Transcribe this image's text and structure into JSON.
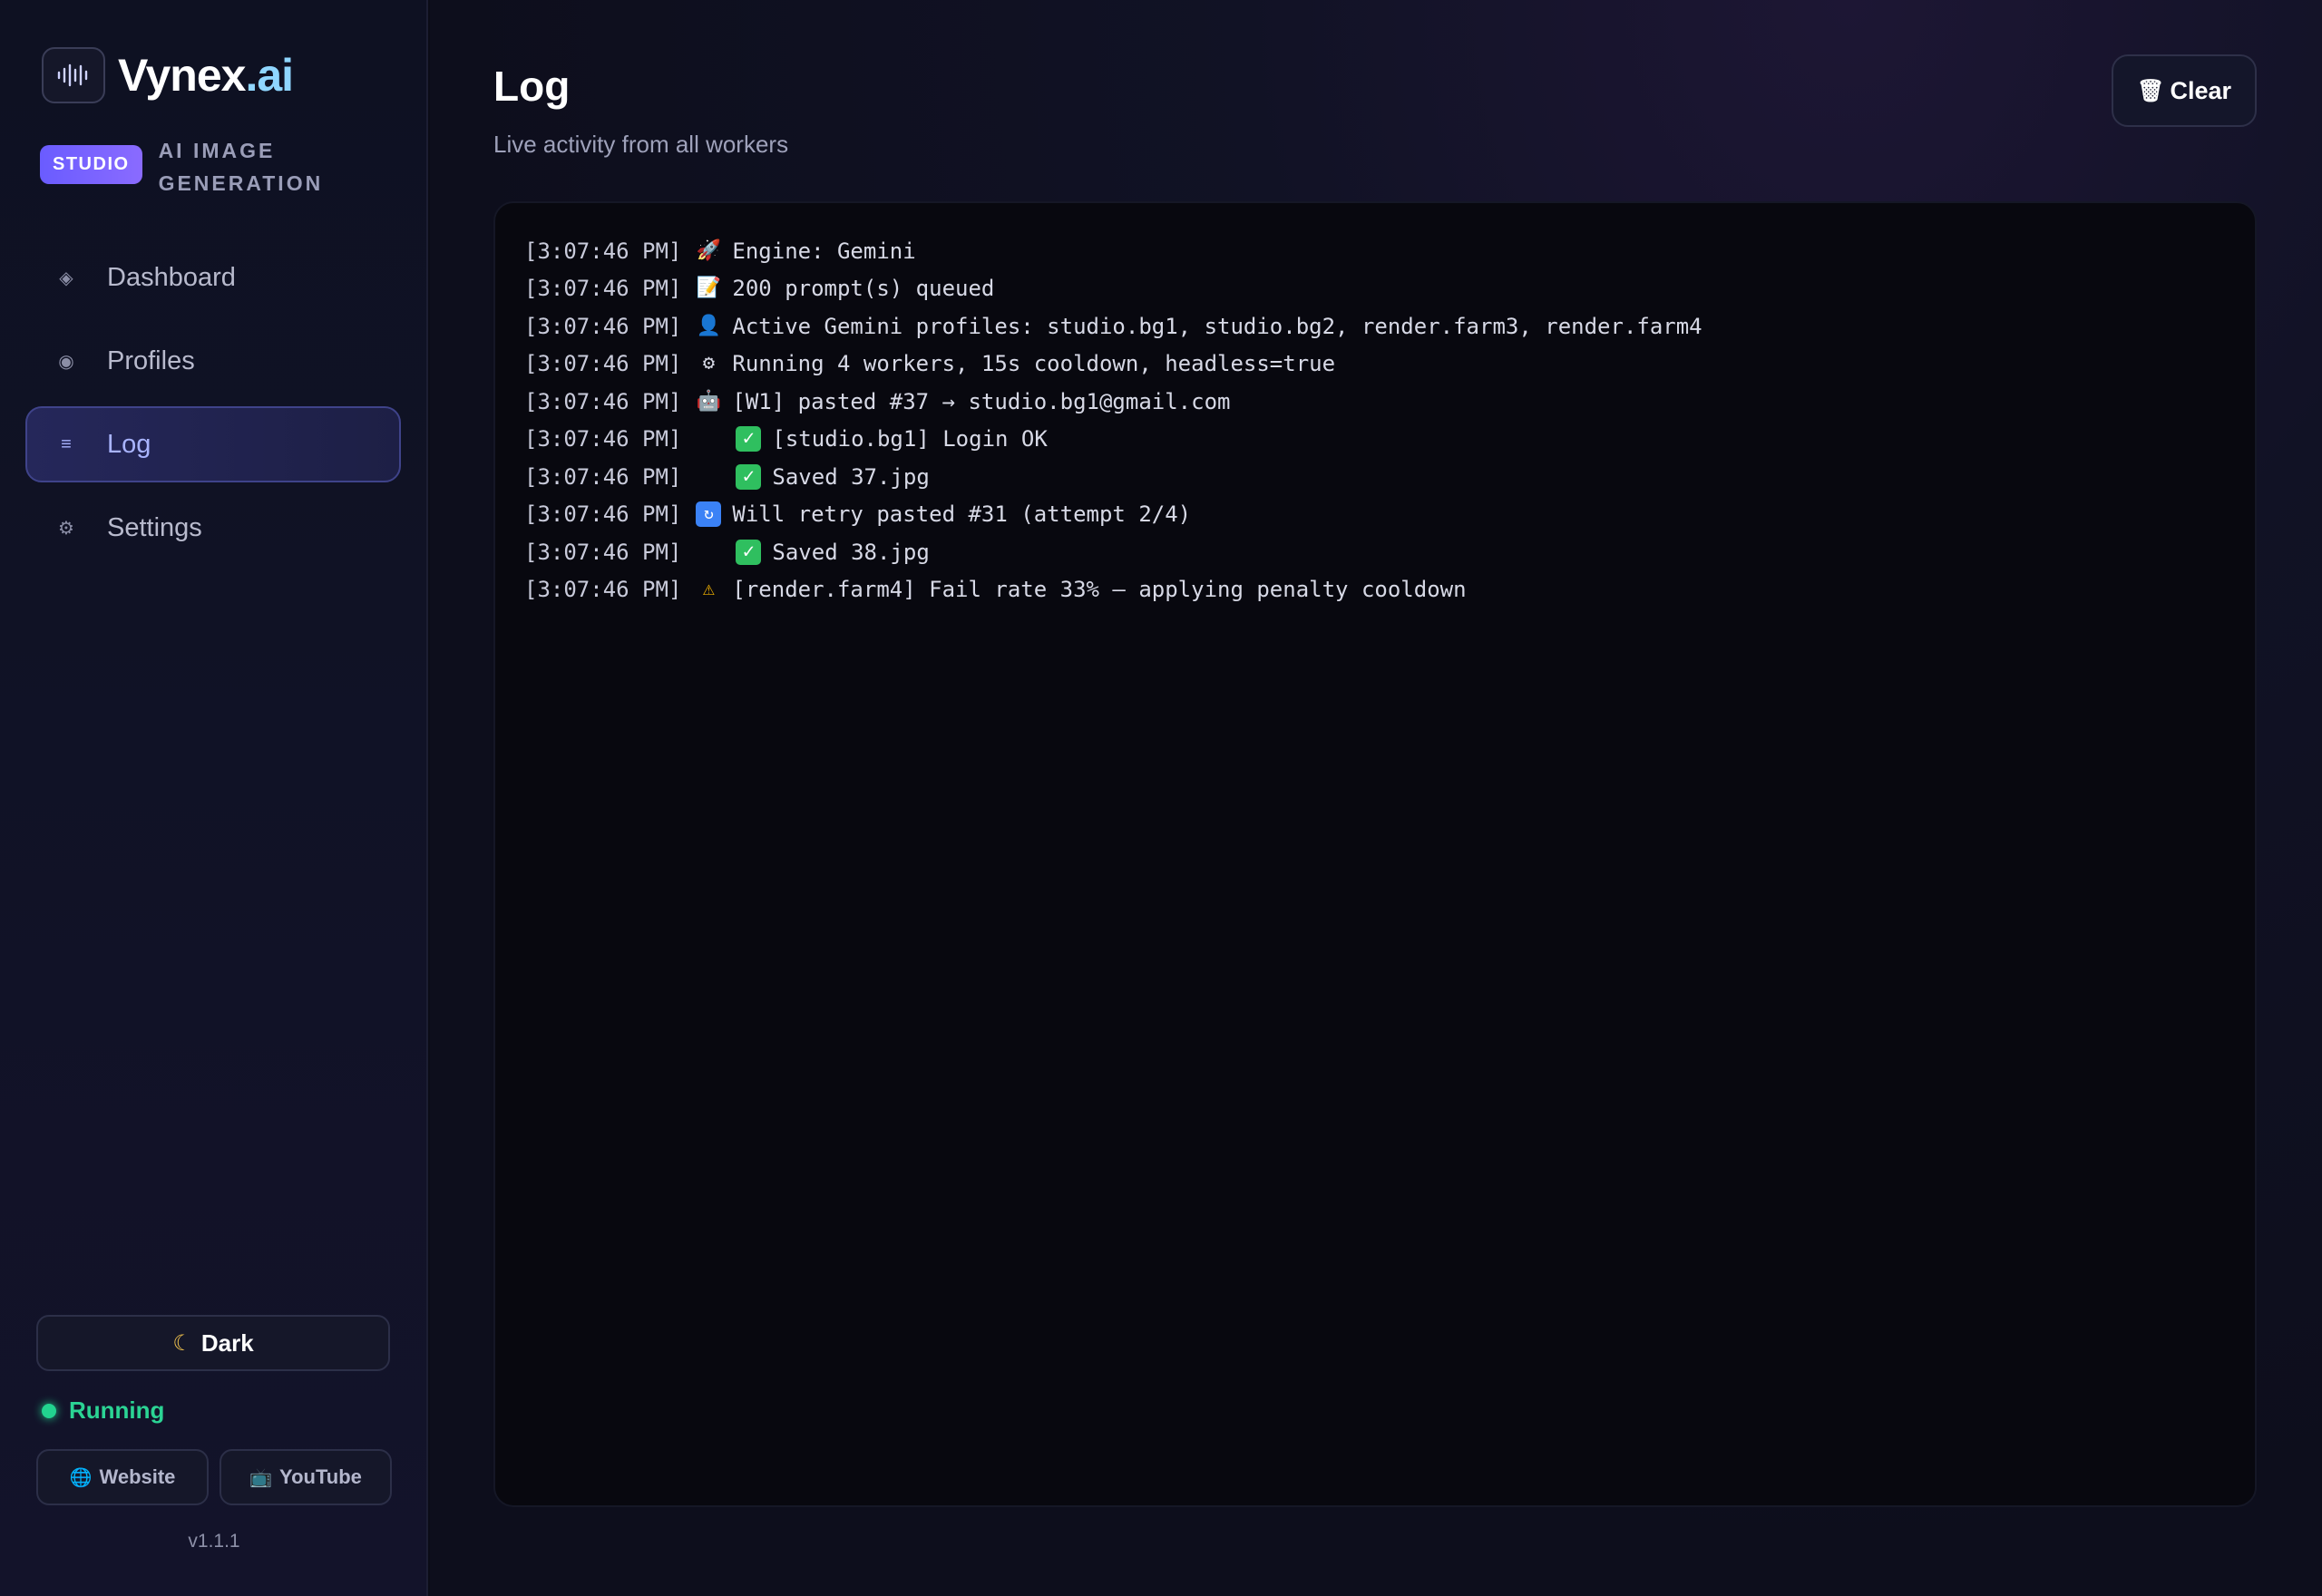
{
  "brand": {
    "name_main": "Vynex",
    "name_accent": ".ai",
    "badge": "STUDIO",
    "tagline_1": "AI IMAGE",
    "tagline_2": "GENERATION"
  },
  "nav": [
    {
      "label": "Dashboard",
      "icon": "diamond-icon"
    },
    {
      "label": "Profiles",
      "icon": "circle-icon"
    },
    {
      "label": "Log",
      "icon": "list-icon",
      "active": true
    },
    {
      "label": "Settings",
      "icon": "gear-icon"
    }
  ],
  "theme_toggle": {
    "label": "Dark",
    "icon": "moon-icon"
  },
  "status": {
    "label": "Running",
    "color": "#22d38f"
  },
  "links": {
    "website": "Website",
    "youtube": "YouTube"
  },
  "version": "v1.1.1",
  "header": {
    "title": "Log",
    "subtitle": "Live activity from all workers",
    "clear_label": "Clear"
  },
  "log": [
    {
      "time": "[3:07:46 PM]",
      "icon": "rocket-icon",
      "text": "Engine: Gemini"
    },
    {
      "time": "[3:07:46 PM]",
      "icon": "memo-icon",
      "text": "200 prompt(s) queued"
    },
    {
      "time": "[3:07:46 PM]",
      "icon": "user-icon",
      "text": "Active Gemini profiles: studio.bg1, studio.bg2, render.farm3, render.farm4"
    },
    {
      "time": "[3:07:46 PM]",
      "icon": "gear-icon",
      "text": "Running 4 workers, 15s cooldown, headless=true"
    },
    {
      "time": "[3:07:46 PM]",
      "icon": "robot-icon",
      "text": "[W1] pasted #37 → studio.bg1@gmail.com"
    },
    {
      "time": "[3:07:46 PM]",
      "icon": "check-icon",
      "text": "[studio.bg1] Login OK"
    },
    {
      "time": "[3:07:46 PM]",
      "icon": "check-icon",
      "text": "Saved 37.jpg"
    },
    {
      "time": "[3:07:46 PM]",
      "icon": "retry-icon",
      "text": "Will retry pasted #31 (attempt 2/4)"
    },
    {
      "time": "[3:07:46 PM]",
      "icon": "check-icon",
      "text": "Saved 38.jpg"
    },
    {
      "time": "[3:07:46 PM]",
      "icon": "warning-icon",
      "text": "[render.farm4] Fail rate 33% — applying penalty cooldown"
    }
  ]
}
